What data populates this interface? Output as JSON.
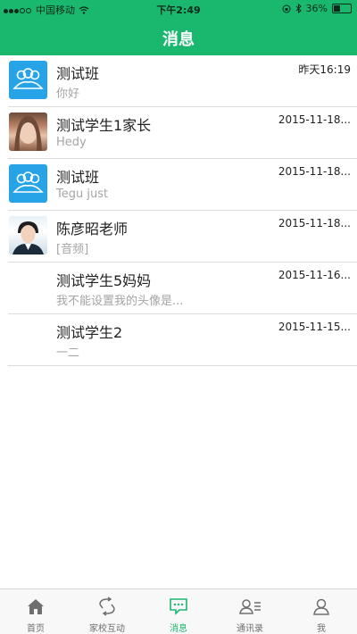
{
  "status_bar": {
    "carrier": "中国移动",
    "time": "下午2:49",
    "battery": "36%"
  },
  "header": {
    "title": "消息"
  },
  "messages": [
    {
      "name": "测试班",
      "preview": "你好",
      "time": "昨天16:19",
      "avatar": "group-icon"
    },
    {
      "name": "测试学生1家长",
      "preview": "Hedy",
      "time": "2015-11-18...",
      "avatar": "user-photo"
    },
    {
      "name": "测试班",
      "preview": "Tegu just",
      "time": "2015-11-18...",
      "avatar": "group-icon"
    },
    {
      "name": "陈彦昭老师",
      "preview": "[音频]",
      "time": "2015-11-18...",
      "avatar": "user-photo"
    },
    {
      "name": "测试学生5妈妈",
      "preview": "我不能设置我的头像是...",
      "time": "2015-11-16...",
      "avatar": "none"
    },
    {
      "name": "测试学生2",
      "preview": "一二",
      "time": "2015-11-15...",
      "avatar": "none"
    }
  ],
  "tabbar": {
    "items": [
      {
        "label": "首页",
        "icon": "home-icon"
      },
      {
        "label": "家校互动",
        "icon": "interaction-icon"
      },
      {
        "label": "消息",
        "icon": "message-icon"
      },
      {
        "label": "通讯录",
        "icon": "contacts-icon"
      },
      {
        "label": "我",
        "icon": "profile-icon"
      }
    ],
    "active_index": 2,
    "accent_color": "#1ab86e"
  }
}
